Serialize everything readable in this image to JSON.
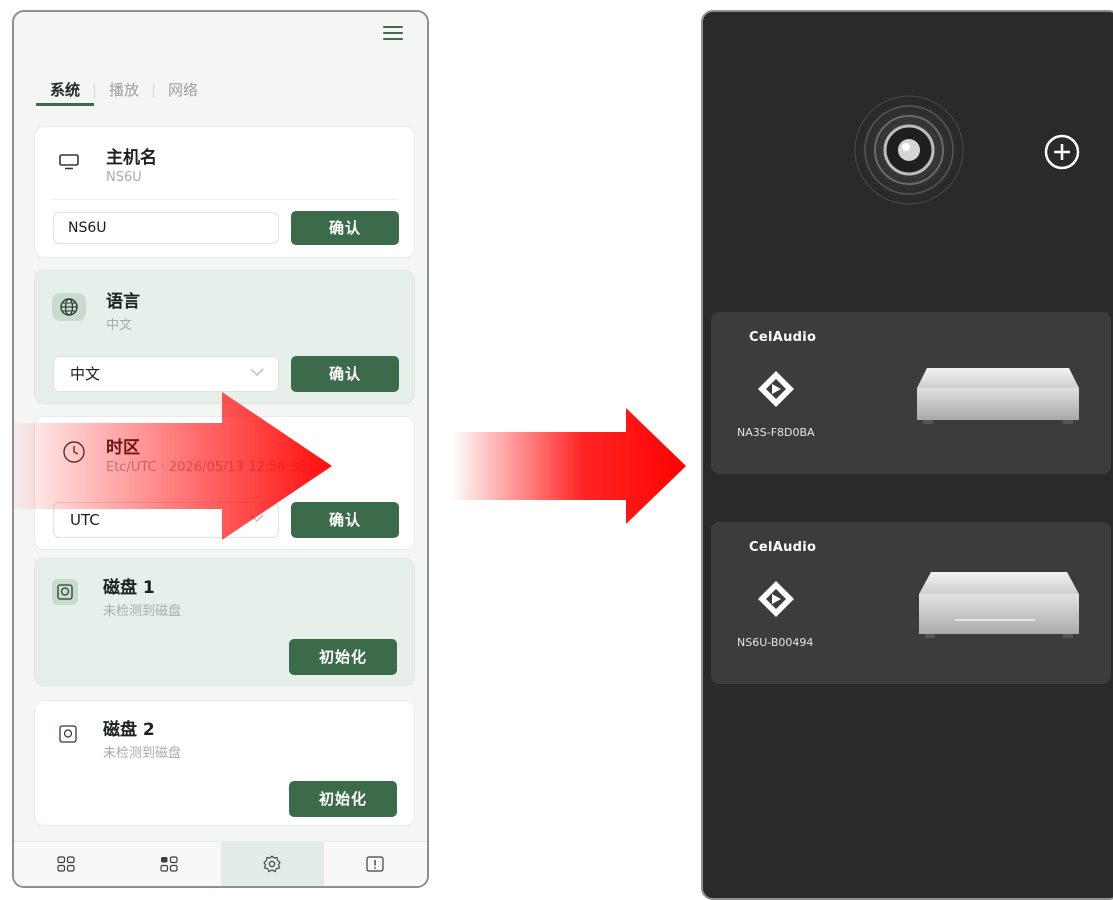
{
  "left_screen": {
    "tabs": [
      {
        "label": "系统",
        "active": true
      },
      {
        "label": "播放",
        "active": false
      },
      {
        "label": "网络",
        "active": false
      }
    ],
    "hostname": {
      "title": "主机名",
      "subtitle": "NS6U",
      "input_value": "NS6U",
      "button": "确认"
    },
    "language": {
      "title": "语言",
      "subtitle": "中文",
      "selected": "中文",
      "button": "确认"
    },
    "timezone": {
      "title": "时区",
      "subtitle": "Etc/UTC · 2026/05/13 12:56:36",
      "selected": "UTC",
      "button": "确认"
    },
    "disk1": {
      "title": "磁盘 1",
      "subtitle": "未检测到磁盘",
      "button": "初始化"
    },
    "disk2": {
      "title": "磁盘 2",
      "subtitle": "未检测到磁盘",
      "button": "初始化"
    },
    "bottom_nav": [
      "grid-icon",
      "checklist-icon",
      "settings-icon",
      "alert-icon"
    ],
    "accent_color": "#3c6b4c"
  },
  "right_screen": {
    "devices": [
      {
        "brand": "CelAudio",
        "name": "NA3S-F8D0BA"
      },
      {
        "brand": "CelAudio",
        "name": "NS6U-B00494"
      }
    ],
    "background_color": "#2a2a2a"
  },
  "arrow_color": "#ff0000"
}
